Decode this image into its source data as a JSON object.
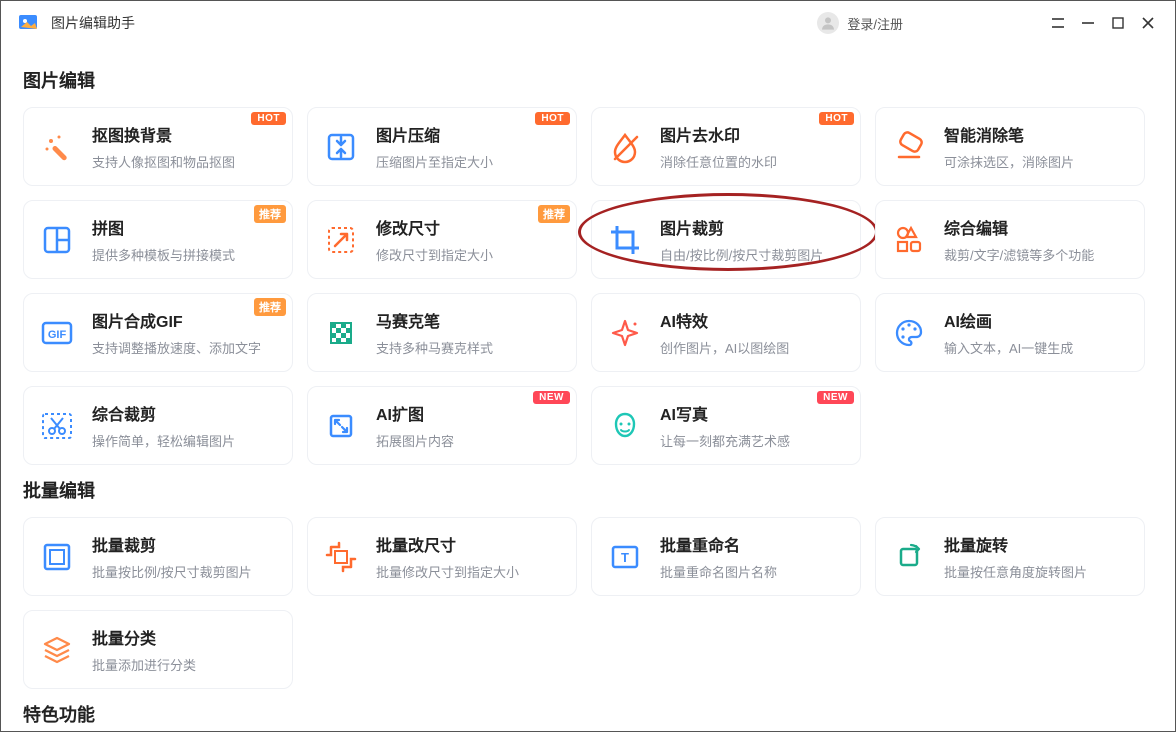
{
  "titlebar": {
    "app_title": "图片编辑助手",
    "login": "登录/注册"
  },
  "sections": [
    {
      "title": "图片编辑",
      "cards": [
        {
          "title": "抠图换背景",
          "desc": "支持人像抠图和物品抠图",
          "badge": "HOT",
          "badge_class": "badge-hot",
          "icon": "magic-wand"
        },
        {
          "title": "图片压缩",
          "desc": "压缩图片至指定大小",
          "badge": "HOT",
          "badge_class": "badge-hot",
          "icon": "compress"
        },
        {
          "title": "图片去水印",
          "desc": "消除任意位置的水印",
          "badge": "HOT",
          "badge_class": "badge-hot",
          "icon": "no-drop"
        },
        {
          "title": "智能消除笔",
          "desc": "可涂抹选区，消除图片",
          "badge": "",
          "badge_class": "",
          "icon": "eraser"
        },
        {
          "title": "拼图",
          "desc": "提供多种模板与拼接模式",
          "badge": "推荐",
          "badge_class": "badge-recommend",
          "icon": "layout"
        },
        {
          "title": "修改尺寸",
          "desc": "修改尺寸到指定大小",
          "badge": "推荐",
          "badge_class": "badge-recommend",
          "icon": "resize"
        },
        {
          "title": "图片裁剪",
          "desc": "自由/按比例/按尺寸裁剪图片",
          "badge": "",
          "badge_class": "",
          "icon": "crop",
          "highlight": true
        },
        {
          "title": "综合编辑",
          "desc": "裁剪/文字/滤镜等多个功能",
          "badge": "",
          "badge_class": "",
          "icon": "shapes"
        },
        {
          "title": "图片合成GIF",
          "desc": "支持调整播放速度、添加文字",
          "badge": "推荐",
          "badge_class": "badge-recommend",
          "icon": "gif"
        },
        {
          "title": "马赛克笔",
          "desc": "支持多种马赛克样式",
          "badge": "",
          "badge_class": "",
          "icon": "mosaic"
        },
        {
          "title": "AI特效",
          "desc": "创作图片，AI以图绘图",
          "badge": "",
          "badge_class": "",
          "icon": "sparkle"
        },
        {
          "title": "AI绘画",
          "desc": "输入文本，AI一键生成",
          "badge": "",
          "badge_class": "",
          "icon": "palette"
        },
        {
          "title": "综合裁剪",
          "desc": "操作简单，轻松编辑图片",
          "badge": "",
          "badge_class": "",
          "icon": "scissors"
        },
        {
          "title": "AI扩图",
          "desc": "拓展图片内容",
          "badge": "NEW",
          "badge_class": "badge-new",
          "icon": "expand"
        },
        {
          "title": "AI写真",
          "desc": "让每一刻都充满艺术感",
          "badge": "NEW",
          "badge_class": "badge-new",
          "icon": "portrait"
        }
      ]
    },
    {
      "title": "批量编辑",
      "cards": [
        {
          "title": "批量裁剪",
          "desc": "批量按比例/按尺寸裁剪图片",
          "badge": "",
          "badge_class": "",
          "icon": "batch-crop"
        },
        {
          "title": "批量改尺寸",
          "desc": "批量修改尺寸到指定大小",
          "badge": "",
          "badge_class": "",
          "icon": "batch-resize"
        },
        {
          "title": "批量重命名",
          "desc": "批量重命名图片名称",
          "badge": "",
          "badge_class": "",
          "icon": "rename"
        },
        {
          "title": "批量旋转",
          "desc": "批量按任意角度旋转图片",
          "badge": "",
          "badge_class": "",
          "icon": "rotate"
        },
        {
          "title": "批量分类",
          "desc": "批量添加进行分类",
          "badge": "",
          "badge_class": "",
          "icon": "stack"
        }
      ]
    },
    {
      "title": "特色功能",
      "cards": []
    }
  ]
}
